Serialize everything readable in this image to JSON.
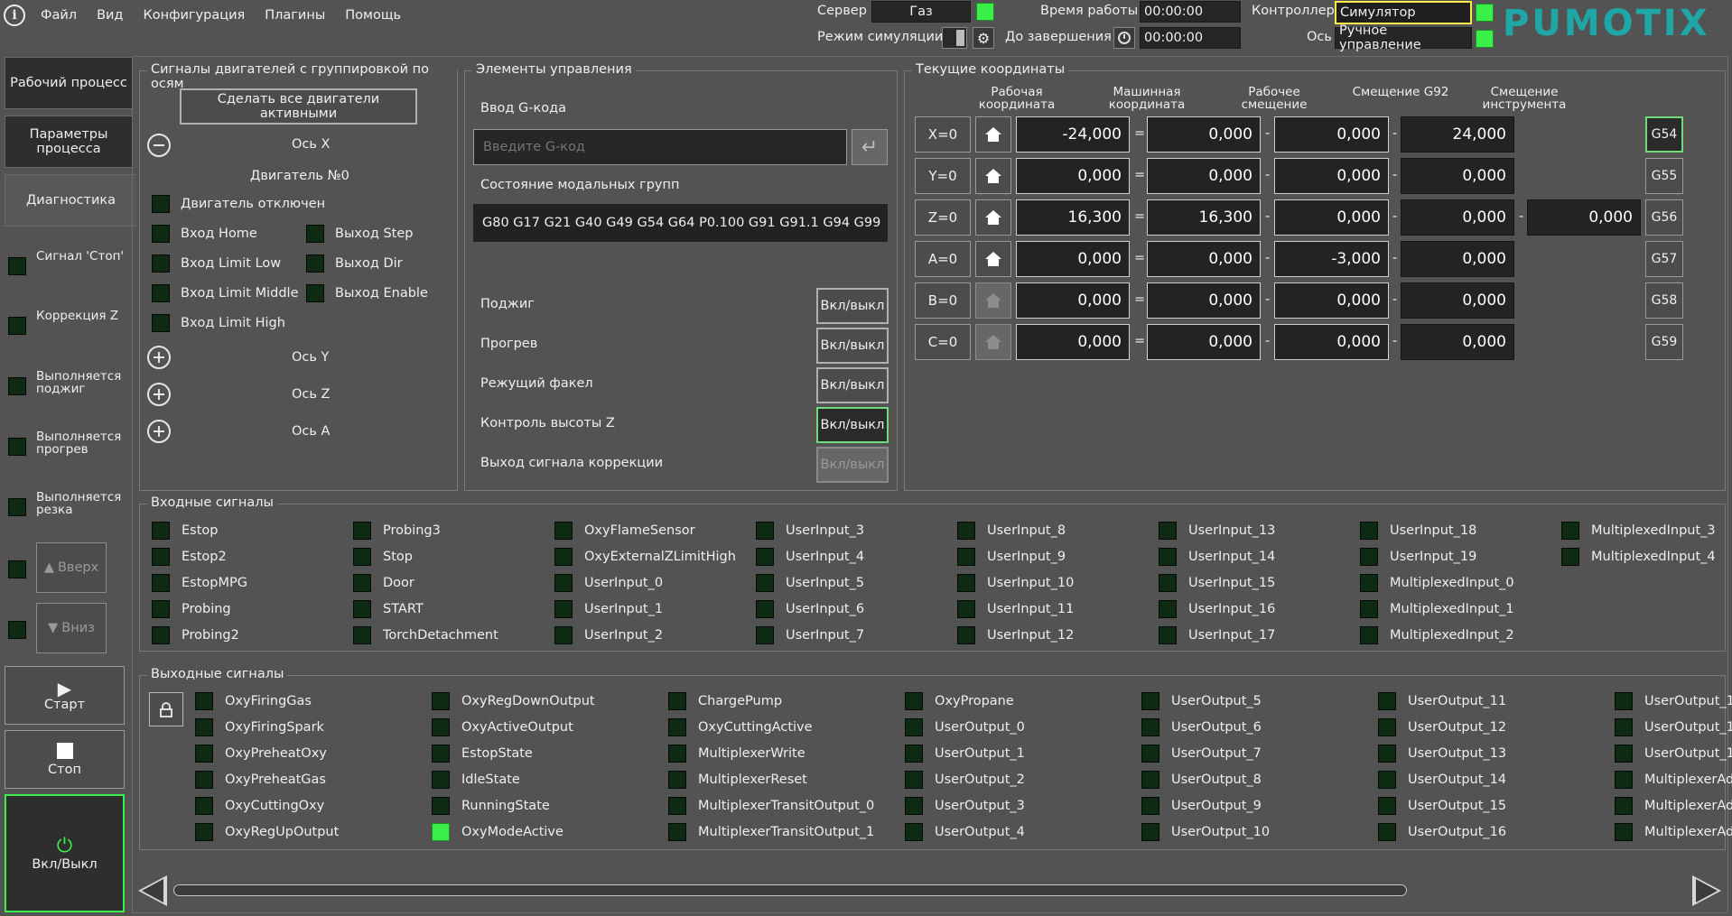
{
  "menu": {
    "info_icon": "info-icon",
    "items": [
      "Файл",
      "Вид",
      "Конфигурация",
      "Плагины",
      "Помощь"
    ]
  },
  "status": {
    "server_label": "Сервер",
    "server_value": "Газ",
    "sim_label": "Режим симуляции",
    "uptime_label": "Время работы",
    "uptime_value": "00:00:00",
    "remaining_label": "До завершения",
    "remaining_value": "00:00:00",
    "controller_label": "Контроллер",
    "controller_value": "Симулятор",
    "z_axis_label": "Ось Z",
    "z_axis_value": "Ручное управление",
    "logo": "PUMOTIX"
  },
  "sidebar": {
    "tabs": [
      "Рабочий процесс",
      "Параметры процесса",
      "Диагностика"
    ],
    "indicators": [
      "Сигнал 'Стоп'",
      "Коррекция Z",
      "Выполняется поджиг",
      "Выполняется прогрев",
      "Выполняется резка"
    ],
    "up_label": "Вверх",
    "down_label": "Вниз",
    "start_label": "Старт",
    "stop_label": "Стоп",
    "power_label": "Вкл/Выкл"
  },
  "motors": {
    "title": "Сигналы двигателей с группировкой по осям",
    "make_all_active": "Сделать все двигатели активными",
    "axis_x": "Ось X",
    "motor_title": "Двигатель №0",
    "motor_disabled": "Двигатель отключен",
    "left_signals": [
      "Вход Home",
      "Вход Limit Low",
      "Вход Limit Middle",
      "Вход Limit High"
    ],
    "right_signals": [
      "Выход Step",
      "Выход Dir",
      "Выход Enable"
    ],
    "axis_y": "Ось Y",
    "axis_z": "Ось Z",
    "axis_a": "Ось A"
  },
  "controls": {
    "title": "Элементы управления",
    "gcode_label": "Ввод G-кода",
    "gcode_placeholder": "Введите G-код",
    "modal_label": "Состояние модальных групп",
    "modal_value": "G80 G17 G21 G40 G49 G54 G64 P0.100 G91 G91.1 G94 G99",
    "toggles": [
      {
        "label": "Поджиг",
        "button": "Вкл/выкл"
      },
      {
        "label": "Прогрев",
        "button": "Вкл/выкл"
      },
      {
        "label": "Режущий факел",
        "button": "Вкл/выкл"
      },
      {
        "label": "Контроль высоты Z",
        "button": "Вкл/выкл"
      },
      {
        "label": "Выход сигнала коррекции",
        "button": "Вкл/выкл"
      }
    ]
  },
  "coords": {
    "title": "Текущие координаты",
    "headers": [
      "Рабочая координата",
      "Машинная координата",
      "Рабочее смещение",
      "Смещение G92",
      "Смещение инструмента"
    ],
    "rows": [
      {
        "axis": "X=0",
        "work": "-24,000",
        "machine": "0,000",
        "offset": "0,000",
        "g92": "24,000",
        "tool": "",
        "g": "G54"
      },
      {
        "axis": "Y=0",
        "work": "0,000",
        "machine": "0,000",
        "offset": "0,000",
        "g92": "0,000",
        "tool": "",
        "g": "G55"
      },
      {
        "axis": "Z=0",
        "work": "16,300",
        "machine": "16,300",
        "offset": "0,000",
        "g92": "0,000",
        "tool": "0,000",
        "g": "G56"
      },
      {
        "axis": "A=0",
        "work": "0,000",
        "machine": "0,000",
        "offset": "-3,000",
        "g92": "0,000",
        "tool": "",
        "g": "G57"
      },
      {
        "axis": "B=0",
        "work": "0,000",
        "machine": "0,000",
        "offset": "0,000",
        "g92": "0,000",
        "tool": "",
        "g": "G58"
      },
      {
        "axis": "C=0",
        "work": "0,000",
        "machine": "0,000",
        "offset": "0,000",
        "g92": "0,000",
        "tool": "",
        "g": "G59"
      }
    ],
    "eq": "=",
    "minus": "-"
  },
  "inputs": {
    "title": "Входные сигналы",
    "columns": [
      [
        "Estop",
        "Estop2",
        "EstopMPG",
        "Probing",
        "Probing2"
      ],
      [
        "Probing3",
        "Stop",
        "Door",
        "START",
        "TorchDetachment"
      ],
      [
        "OxyFlameSensor",
        "OxyExternalZLimitHigh",
        "UserInput_0",
        "UserInput_1",
        "UserInput_2"
      ],
      [
        "UserInput_3",
        "UserInput_4",
        "UserInput_5",
        "UserInput_6",
        "UserInput_7"
      ],
      [
        "UserInput_8",
        "UserInput_9",
        "UserInput_10",
        "UserInput_11",
        "UserInput_12"
      ],
      [
        "UserInput_13",
        "UserInput_14",
        "UserInput_15",
        "UserInput_16",
        "UserInput_17"
      ],
      [
        "UserInput_18",
        "UserInput_19",
        "MultiplexedInput_0",
        "MultiplexedInput_1",
        "MultiplexedInput_2"
      ],
      [
        "MultiplexedInput_3",
        "MultiplexedInput_4"
      ]
    ]
  },
  "outputs": {
    "title": "Выходные сигналы",
    "columns": [
      [
        "OxyFiringGas",
        "OxyFiringSpark",
        "OxyPreheatOxy",
        "OxyPreheatGas",
        "OxyCuttingOxy",
        "OxyRegUpOutput"
      ],
      [
        "OxyRegDownOutput",
        "OxyActiveOutput",
        "EstopState",
        "IdleState",
        "RunningState",
        "OxyModeActive"
      ],
      [
        "ChargePump",
        "OxyCuttingActive",
        "MultiplexerWrite",
        "MultiplexerReset",
        "MultiplexerTransitOutput_0",
        "MultiplexerTransitOutput_1"
      ],
      [
        "OxyPropane",
        "UserOutput_0",
        "UserOutput_1",
        "UserOutput_2",
        "UserOutput_3",
        "UserOutput_4"
      ],
      [
        "UserOutput_5",
        "UserOutput_6",
        "UserOutput_7",
        "UserOutput_8",
        "UserOutput_9",
        "UserOutput_10"
      ],
      [
        "UserOutput_11",
        "UserOutput_12",
        "UserOutput_13",
        "UserOutput_14",
        "UserOutput_15",
        "UserOutput_16"
      ],
      [
        "UserOutput_1",
        "UserOutput_1",
        "UserOutput_1",
        "MultiplexerAd",
        "MultiplexerAd",
        "MultiplexerAd"
      ]
    ],
    "active": "OxyModeActive"
  },
  "colors": {
    "accent_logo": "#1fa7a8",
    "led_on": "#3bef4a",
    "led_off": "#0f2a13",
    "highlight": "#ffe94a"
  }
}
